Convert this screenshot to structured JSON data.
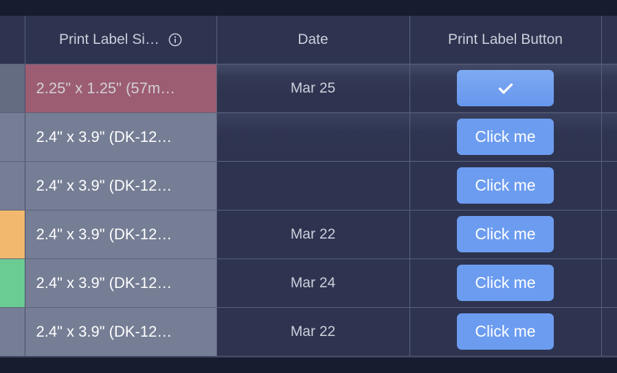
{
  "table": {
    "columns": [
      {
        "key": "status",
        "label": "",
        "icon": null
      },
      {
        "key": "size",
        "label": "Print Label Si…",
        "icon": "info-icon"
      },
      {
        "key": "date",
        "label": "Date",
        "icon": null
      },
      {
        "key": "button",
        "label": "Print Label Button",
        "icon": null
      },
      {
        "key": "tail",
        "label": "",
        "icon": null
      }
    ],
    "rows": [
      {
        "status_color": "#646c82",
        "size": "2.25\" x 1.25\" (57m…",
        "size_cell_color": "#9c5d73",
        "size_text_muted": true,
        "date": "Mar 25",
        "button_label": "",
        "button_state": "checked",
        "button_icon": "check-icon"
      },
      {
        "status_color": "#767e95",
        "size": "2.4\" x 3.9\" (DK-12…",
        "size_cell_color": "#767e95",
        "size_text_muted": false,
        "date": "",
        "button_label": "Click me",
        "button_state": "default",
        "button_icon": null
      },
      {
        "status_color": "#767e95",
        "size": "2.4\" x 3.9\" (DK-12…",
        "size_cell_color": "#767e95",
        "size_text_muted": false,
        "date": "",
        "button_label": "Click me",
        "button_state": "default",
        "button_icon": null
      },
      {
        "status_color": "#f2b96e",
        "size": "2.4\" x 3.9\" (DK-12…",
        "size_cell_color": "#767e95",
        "size_text_muted": false,
        "date": "Mar 22",
        "button_label": "Click me",
        "button_state": "default",
        "button_icon": null
      },
      {
        "status_color": "#6bcc93",
        "size": "2.4\" x 3.9\" (DK-12…",
        "size_cell_color": "#767e95",
        "size_text_muted": false,
        "date": "Mar 24",
        "button_label": "Click me",
        "button_state": "default",
        "button_icon": null
      },
      {
        "status_color": "#767e95",
        "size": "2.4\" x 3.9\" (DK-12…",
        "size_cell_color": "#767e95",
        "size_text_muted": false,
        "date": "Mar 22",
        "button_label": "Click me",
        "button_state": "default",
        "button_icon": null
      }
    ]
  },
  "theme": {
    "chrome_bg": "#171c2e",
    "header_bg": "#2e3450",
    "cell_bg": "#2e3450",
    "grid_line": "#5a6178",
    "accent_button": "#6c9cf0",
    "text_primary": "#ccd0db",
    "size_cell_bg": "#767e95",
    "highlight_row_bg": "#9c5d73"
  }
}
